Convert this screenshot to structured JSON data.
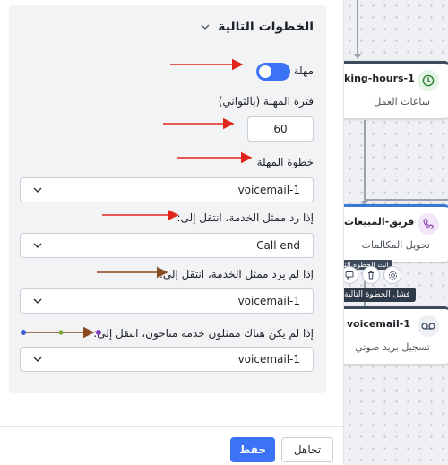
{
  "panel": {
    "section_title": "الخطوات التالية",
    "timeout_label": "مهلة",
    "timeout_enabled": true,
    "timeout_duration_label": "فترة المهلة (بالثواني)",
    "timeout_duration_value": "60",
    "timeout_step_label": "خطوة المهلة",
    "timeout_step_value": "voicemail-1",
    "agent_answers_label": "إذا رد ممثل الخدمة، انتقل إلى:",
    "agent_answers_value": "Call end",
    "agent_no_answer_label": "إذا لم يرد ممثل الخدمة، انتقل إلى:",
    "agent_no_answer_value": "voicemail-1",
    "no_agents_label": "إذا لم يكن هناك ممثلون خدمة متاحون، انتقل إلى:",
    "no_agents_value": "voicemail-1"
  },
  "footer": {
    "save_label": "حفظ",
    "ignore_label": "تجاهل"
  },
  "canvas": {
    "nodes": [
      {
        "title": "king-hours-1",
        "subtitle": "ساعات العمل",
        "icon": "clock-icon"
      },
      {
        "title": "فريق-المبيعات",
        "subtitle": "تحويل المكالمات",
        "icon": "phone-icon"
      },
      {
        "title": "voicemail-1",
        "subtitle": "تسجيل بريد صوتي",
        "icon": "voicemail-icon"
      }
    ],
    "mini_label": "انت الخطوة التا",
    "fail_tooltip": "فشل الخطوة التالية"
  },
  "colors": {
    "accent": "#3b72f6",
    "annotation_red": "#e0261b",
    "annotation_brown": "#8a4b1e",
    "node_green": "#2e7d32",
    "node_purple": "#8e44ad"
  }
}
